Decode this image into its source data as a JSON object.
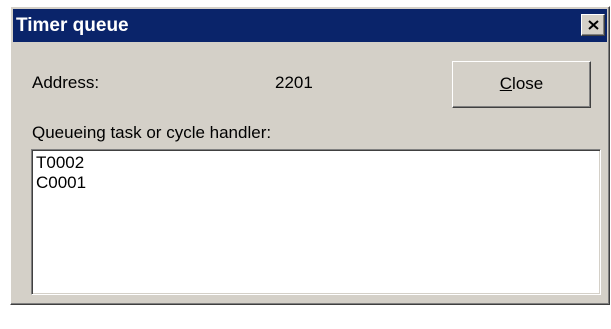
{
  "window": {
    "title": "Timer queue",
    "title_color": "#0a246a",
    "face_color": "#d4d0c8",
    "close_icon": "close-icon"
  },
  "address": {
    "label": "Address:",
    "value": "2201"
  },
  "close_button": {
    "accelerator": "C",
    "label_rest": "lose"
  },
  "queue": {
    "label": "Queueing task or cycle handler:",
    "items": [
      "T0002",
      "C0001"
    ]
  }
}
